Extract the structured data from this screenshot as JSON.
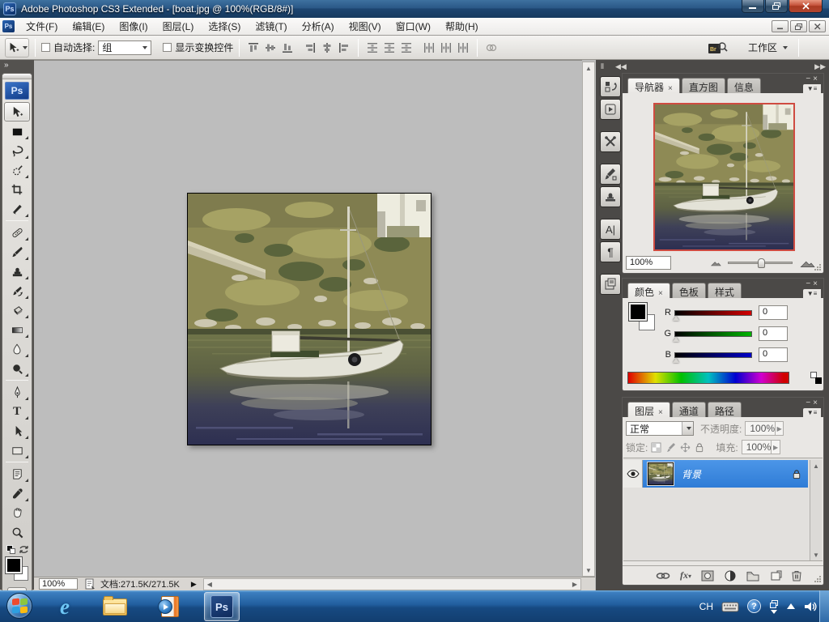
{
  "window": {
    "title": "Adobe Photoshop CS3 Extended - [boat.jpg @ 100%(RGB/8#)]",
    "app_badge": "Ps"
  },
  "menu": {
    "items": [
      "文件(F)",
      "编辑(E)",
      "图像(I)",
      "图层(L)",
      "选择(S)",
      "滤镜(T)",
      "分析(A)",
      "视图(V)",
      "窗口(W)",
      "帮助(H)"
    ]
  },
  "options": {
    "auto_select_label": "自动选择:",
    "auto_select_value": "组",
    "show_transform_label": "显示变换控件",
    "bridge_badge": "Br",
    "workspace_label": "工作区"
  },
  "toolbar": {
    "tools": [
      "move",
      "rectangular-marquee",
      "lasso",
      "quick-selection",
      "crop",
      "slice",
      "healing-brush",
      "brush",
      "clone-stamp",
      "history-brush",
      "eraser",
      "gradient",
      "blur",
      "dodge",
      "pen",
      "type",
      "path-selection",
      "shape",
      "notes",
      "eyedropper",
      "hand",
      "zoom"
    ]
  },
  "dock_panels": [
    "history",
    "actions",
    "tool-presets",
    "brushes",
    "clone-source",
    "character",
    "paragraph",
    "layer-comps"
  ],
  "panels": {
    "navigator": {
      "tabs": [
        "导航器",
        "直方图",
        "信息"
      ],
      "zoom_value": "100%"
    },
    "color": {
      "tabs": [
        "颜色",
        "色板",
        "样式"
      ],
      "channels": [
        {
          "label": "R",
          "value": "0"
        },
        {
          "label": "G",
          "value": "0"
        },
        {
          "label": "B",
          "value": "0"
        }
      ]
    },
    "layers": {
      "tabs": [
        "图层",
        "通道",
        "路径"
      ],
      "blend_mode": "正常",
      "opacity_label": "不透明度:",
      "opacity_value": "100%",
      "lock_label": "锁定:",
      "fill_label": "填充:",
      "fill_value": "100%",
      "layer_name": "背景"
    }
  },
  "statusbar": {
    "zoom_value": "100%",
    "doc_info": "文档:271.5K/271.5K"
  },
  "taskbar": {
    "language_indicator": "CH",
    "ps_badge": "Ps",
    "ie_glyph": "e"
  },
  "colors": {
    "titlebar_blue": "#2a5887",
    "taskbar_blue": "#215e9e",
    "selection_blue": "#2f7cd6",
    "navigator_view_border": "#cf4b41",
    "channel_r": "#d40000",
    "channel_g": "#00b400",
    "channel_b": "#0000c8",
    "foreground_swatch": "#000000",
    "background_swatch": "#ffffff"
  }
}
